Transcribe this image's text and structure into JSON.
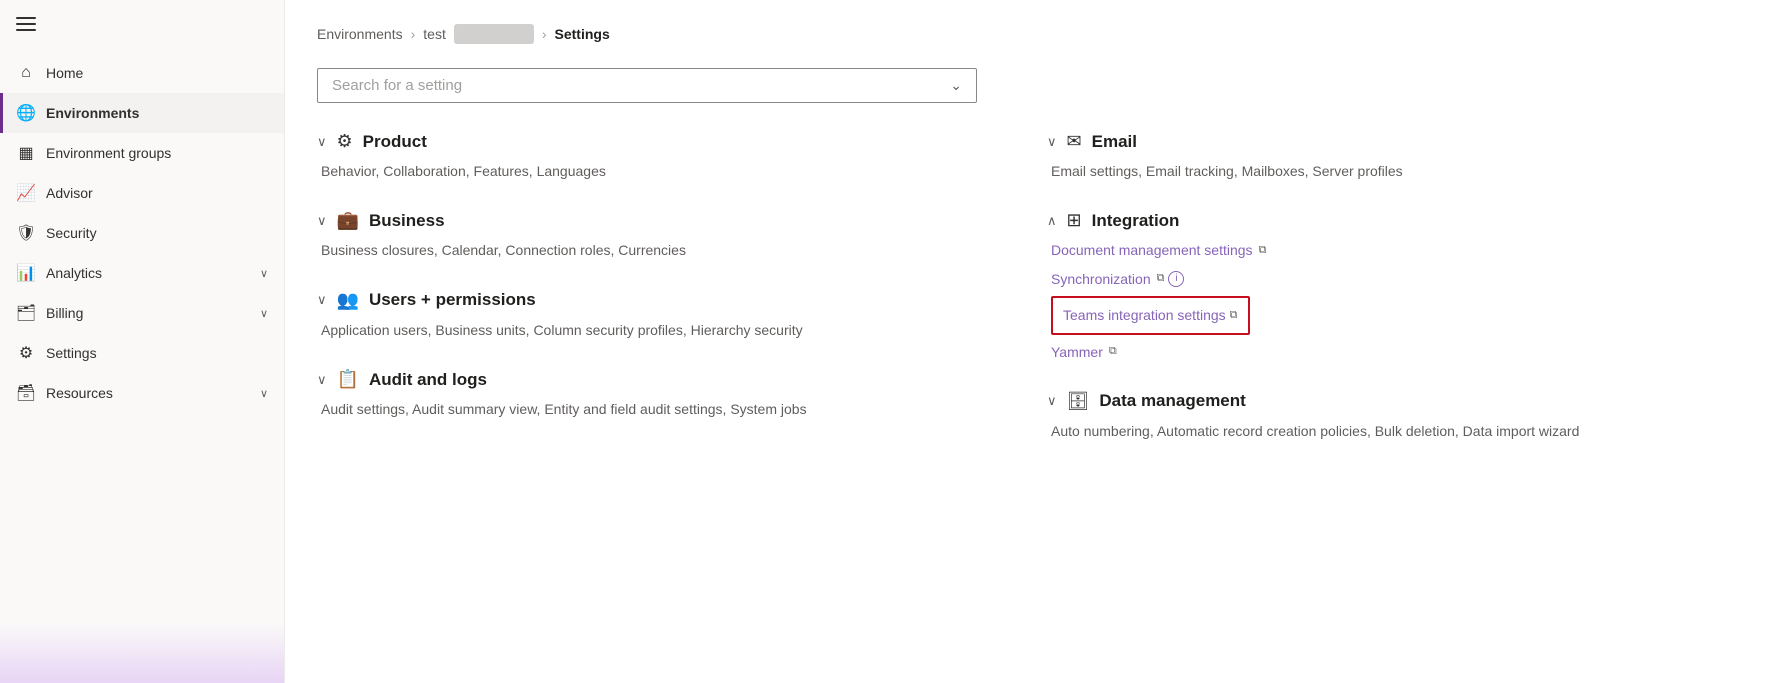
{
  "sidebar": {
    "hamburger_label": "Menu",
    "items": [
      {
        "id": "home",
        "label": "Home",
        "icon": "⌂",
        "active": false,
        "has_chevron": false
      },
      {
        "id": "environments",
        "label": "Environments",
        "icon": "🌐",
        "active": true,
        "has_chevron": false
      },
      {
        "id": "environment-groups",
        "label": "Environment groups",
        "icon": "▦",
        "active": false,
        "has_chevron": false
      },
      {
        "id": "advisor",
        "label": "Advisor",
        "icon": "📈",
        "active": false,
        "has_chevron": false
      },
      {
        "id": "security",
        "label": "Security",
        "icon": "🛡",
        "active": false,
        "has_chevron": false
      },
      {
        "id": "analytics",
        "label": "Analytics",
        "icon": "📊",
        "active": false,
        "has_chevron": true
      },
      {
        "id": "billing",
        "label": "Billing",
        "icon": "🗂",
        "active": false,
        "has_chevron": true
      },
      {
        "id": "settings",
        "label": "Settings",
        "icon": "⚙",
        "active": false,
        "has_chevron": false
      },
      {
        "id": "resources",
        "label": "Resources",
        "icon": "🗃",
        "active": false,
        "has_chevron": true
      }
    ]
  },
  "breadcrumb": {
    "environments": "Environments",
    "test": "test",
    "settings": "Settings"
  },
  "search": {
    "placeholder": "Search for a setting"
  },
  "settings": {
    "columns": [
      {
        "sections": [
          {
            "id": "product",
            "title": "Product",
            "icon": "⚙",
            "collapsed": false,
            "links_text": "Behavior, Collaboration, Features, Languages"
          },
          {
            "id": "business",
            "title": "Business",
            "icon": "💼",
            "collapsed": false,
            "links_text": "Business closures, Calendar, Connection roles, Currencies"
          },
          {
            "id": "users-permissions",
            "title": "Users + permissions",
            "icon": "👥",
            "collapsed": false,
            "links_text": "Application users, Business units, Column security profiles, Hierarchy security"
          },
          {
            "id": "audit-logs",
            "title": "Audit and logs",
            "icon": "📋",
            "collapsed": false,
            "links_text": "Audit settings, Audit summary view, Entity and field audit settings, System jobs"
          }
        ]
      },
      {
        "sections": [
          {
            "id": "email",
            "title": "Email",
            "icon": "✉",
            "collapsed": false,
            "links_text": "Email settings, Email tracking, Mailboxes, Server profiles"
          },
          {
            "id": "integration",
            "title": "Integration",
            "icon": "⊞",
            "collapsed": true,
            "sub_items": [
              {
                "id": "document-management",
                "label": "Document management settings",
                "has_ext": true,
                "has_info": false,
                "highlighted": false
              },
              {
                "id": "synchronization",
                "label": "Synchronization",
                "has_ext": true,
                "has_info": true,
                "highlighted": false
              },
              {
                "id": "teams-integration",
                "label": "Teams integration settings",
                "has_ext": true,
                "has_info": false,
                "highlighted": true
              },
              {
                "id": "yammer",
                "label": "Yammer",
                "has_ext": true,
                "has_info": false,
                "highlighted": false
              }
            ]
          },
          {
            "id": "data-management",
            "title": "Data management",
            "icon": "🗄",
            "collapsed": false,
            "links_text": "Auto numbering, Automatic record creation policies, Bulk deletion, Data import wizard"
          }
        ]
      }
    ]
  }
}
